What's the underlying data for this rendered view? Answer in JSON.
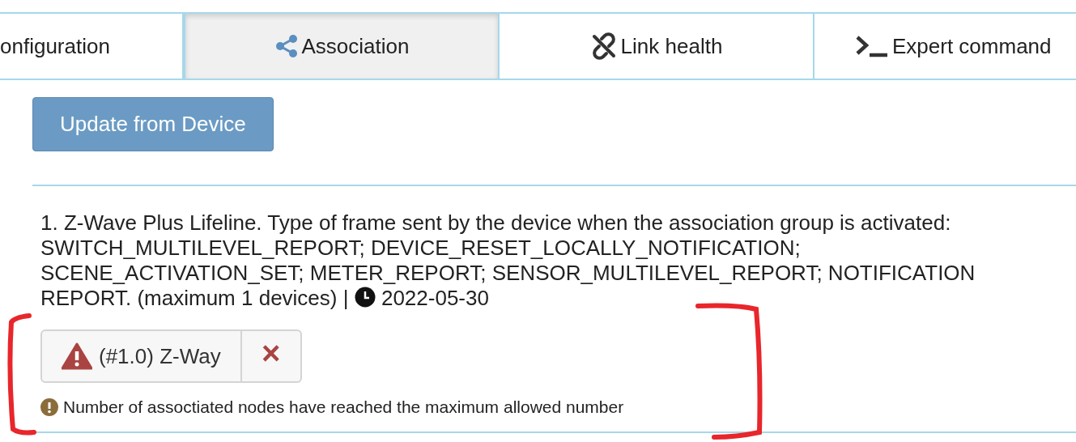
{
  "tabs": [
    {
      "label": "onfiguration",
      "selected": false
    },
    {
      "label": "Association",
      "selected": true
    },
    {
      "label": "Link health",
      "selected": false
    },
    {
      "label": "Expert command",
      "selected": false
    }
  ],
  "update_button": "Update from Device",
  "groups": [
    {
      "description": "1. Z-Wave Plus Lifeline. Type of frame sent by the device when the association group is activated: SWITCH_MULTILEVEL_REPORT; DEVICE_RESET_LOCALLY_NOTIFICATION; SCENE_ACTIVATION_SET; METER_REPORT; SENSOR_MULTILEVEL_REPORT; NOTIFICATION REPORT. (maximum 1 devices) |",
      "date": "2022-05-30",
      "nodes": [
        {
          "label": "(#1.0) Z-Way",
          "warning": true,
          "remove": "×"
        }
      ],
      "message": "Number of assoctiated nodes have reached the maximum allowed number"
    }
  ]
}
